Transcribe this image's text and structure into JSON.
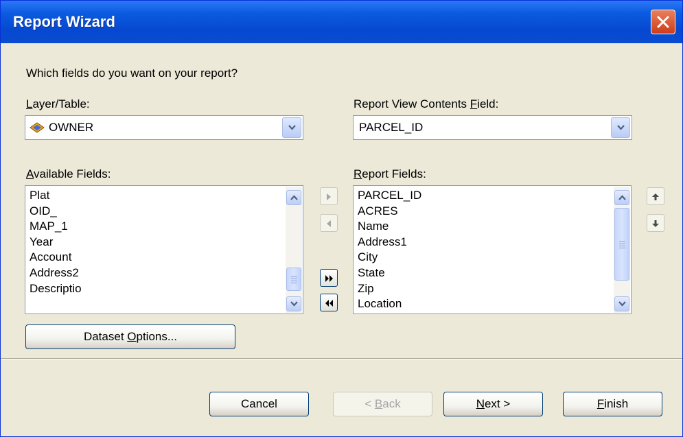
{
  "window": {
    "title": "Report Wizard",
    "close_icon": "close-x-icon",
    "close_color": "#d9532b"
  },
  "prompt": "Which fields do you want on your report?",
  "layer": {
    "label_underlined": "L",
    "label_rest": "ayer/Table:",
    "value": "OWNER",
    "value_icon": "layer-diamond-icon"
  },
  "contents_field": {
    "label_pre": "Report View Contents ",
    "label_underlined": "F",
    "label_rest": "ield:",
    "value": "PARCEL_ID"
  },
  "available": {
    "label_underlined": "A",
    "label_rest": "vailable Fields:",
    "items": [
      "Plat",
      "OID_",
      "MAP_1",
      "Year",
      "Account",
      "Address2",
      "Descriptio"
    ]
  },
  "report": {
    "label_underlined": "R",
    "label_rest": "eport Fields:",
    "items": [
      "PARCEL_ID",
      "ACRES",
      "Name",
      "Address1",
      "City",
      "State",
      "Zip",
      "Location"
    ]
  },
  "transfer_buttons": {
    "add_one": "right-arrow-icon",
    "remove_one": "left-arrow-icon",
    "add_all": "double-right-arrow-icon",
    "remove_all": "double-left-arrow-icon"
  },
  "order_buttons": {
    "up": "up-arrow-icon",
    "down": "down-arrow-icon"
  },
  "dataset_options": {
    "pre": "Dataset ",
    "underlined": "O",
    "rest": "ptions..."
  },
  "footer": {
    "cancel": "Cancel",
    "back_pre": "< ",
    "back_underlined": "B",
    "back_rest": "ack",
    "next_underlined": "N",
    "next_rest": "ext >",
    "finish_underlined": "F",
    "finish_rest": "inish"
  }
}
